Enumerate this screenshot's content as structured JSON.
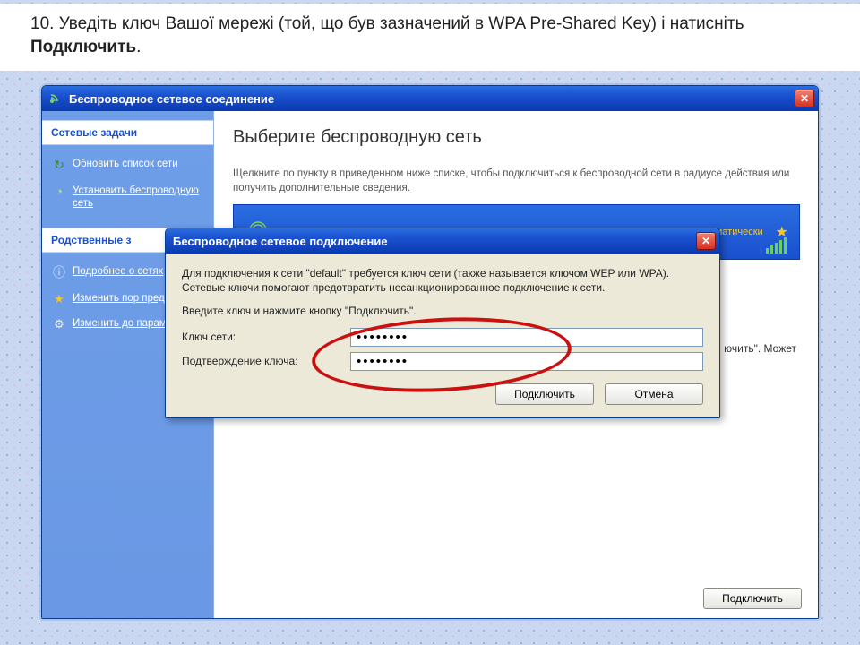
{
  "instruction": {
    "prefix": "10. Уведіть ключ Вашої мережі (той, що був зазначений в WPA Pre-Shared Key) і натисніть ",
    "bold": "Подключить",
    "suffix": "."
  },
  "win1": {
    "title": "Беспроводное сетевое соединение",
    "side": {
      "section1_hdr": "Сетевые задачи",
      "items1": [
        {
          "label": "Обновить список сети"
        },
        {
          "label": "Установить беспроводную сеть"
        }
      ],
      "section2_hdr": "Родственные з",
      "items2": [
        {
          "label": "Подробнее о сетях"
        },
        {
          "label": "Изменить пор предпочтени"
        },
        {
          "label": "Изменить до параметры"
        }
      ]
    },
    "main": {
      "heading": "Выберите беспроводную сеть",
      "desc": "Щелкните по пункту в приведенном ниже списке, чтобы подключиться к беспроводной сети в радиусе действия или получить дополнительные сведения.",
      "network": {
        "name": "default",
        "auto": "автоматически"
      },
      "partial_text": "ючить\". Может",
      "connect_btn": "Подключить"
    }
  },
  "dlg": {
    "title": "Беспроводное сетевое подключение",
    "p1": "Для подключения к сети \"default\" требуется ключ сети (также называется ключом WEP или WPA). Сетевые ключи помогают предотвратить несанкционированное подключение к сети.",
    "p2": "Введите ключ и нажмите кнопку \"Подключить\".",
    "lbl_key": "Ключ сети:",
    "lbl_confirm": "Подтверждение ключа:",
    "val_key": "••••••••",
    "val_confirm": "••••••••",
    "btn_connect": "Подключить",
    "btn_cancel": "Отмена"
  }
}
